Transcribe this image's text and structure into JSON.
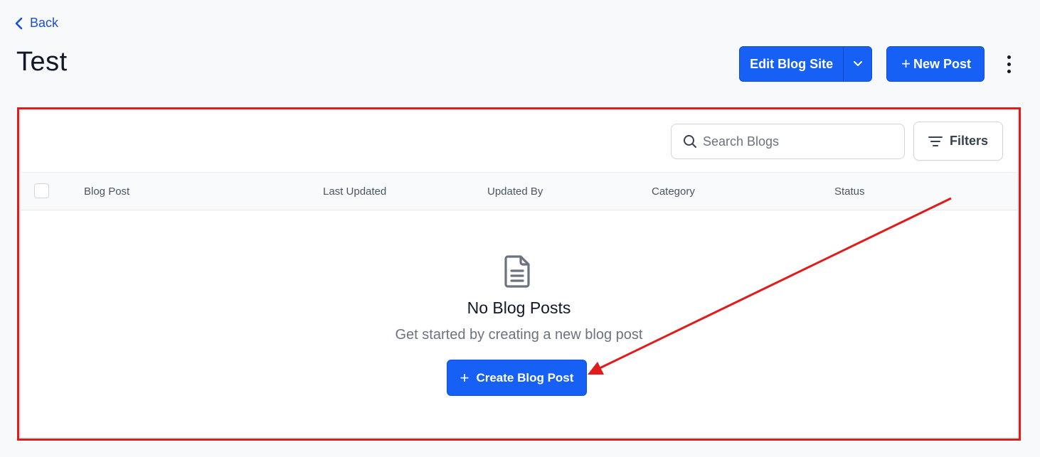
{
  "header": {
    "back_label": "Back",
    "title": "Test",
    "edit_blog_site_label": "Edit Blog Site",
    "new_post_label": "New Post"
  },
  "toolbar": {
    "search_placeholder": "Search Blogs",
    "filters_label": "Filters"
  },
  "table": {
    "columns": [
      "Blog Post",
      "Last Updated",
      "Updated By",
      "Category",
      "Status"
    ]
  },
  "empty_state": {
    "title": "No Blog Posts",
    "subtitle": "Get started by creating a new blog post",
    "button_label": "Create Blog Post"
  },
  "colors": {
    "primary": "#1660f5",
    "annotation": "#e11b1b",
    "link": "#1d4ed8"
  }
}
